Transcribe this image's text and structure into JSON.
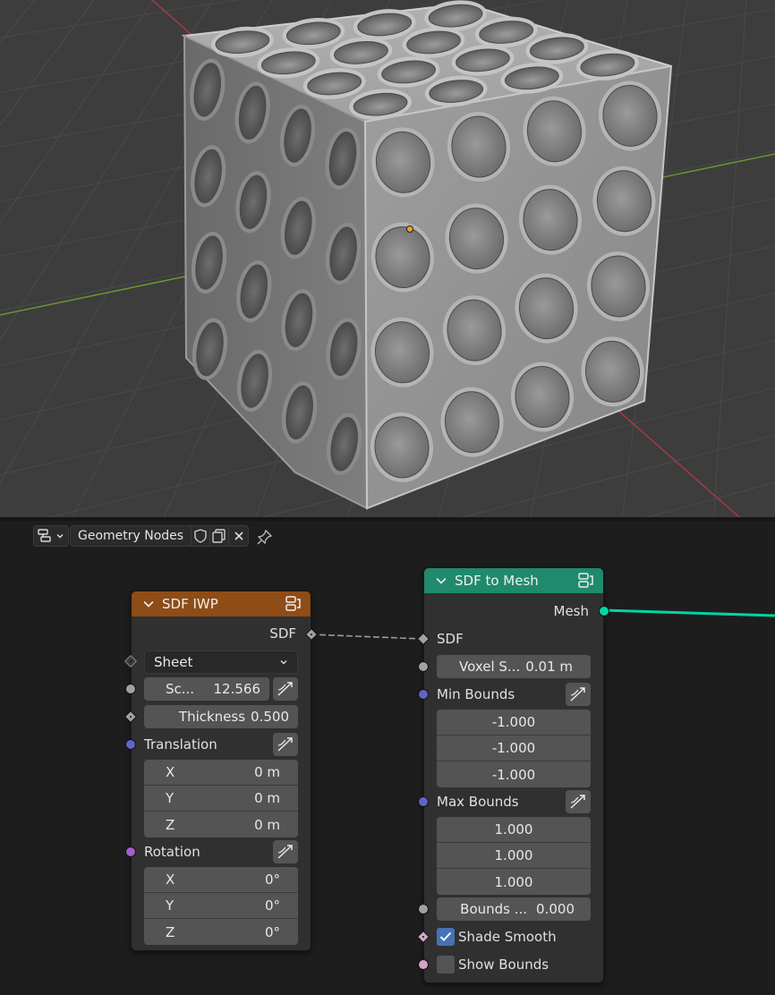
{
  "header": {
    "editor_type_icon": "node-editor-icon",
    "node_group_name": "Geometry Nodes",
    "icons": [
      "fake-user-shield-icon",
      "duplicate-icon",
      "close-icon",
      "pin-icon"
    ]
  },
  "nodes": {
    "sdf_iwp": {
      "title": "SDF IWP",
      "header_color": "#8e4c16",
      "output_sdf": "SDF",
      "mode": "Sheet",
      "scale_label": "Sc...",
      "scale_value": "12.566",
      "thickness_label": "Thickness",
      "thickness_value": "0.500",
      "translation_label": "Translation",
      "translation": [
        {
          "axis": "X",
          "value": "0 m"
        },
        {
          "axis": "Y",
          "value": "0 m"
        },
        {
          "axis": "Z",
          "value": "0 m"
        }
      ],
      "rotation_label": "Rotation",
      "rotation": [
        {
          "axis": "X",
          "value": "0°"
        },
        {
          "axis": "Y",
          "value": "0°"
        },
        {
          "axis": "Z",
          "value": "0°"
        }
      ]
    },
    "sdf_to_mesh": {
      "title": "SDF to Mesh",
      "header_color": "#1f8a6c",
      "output_mesh": "Mesh",
      "input_sdf": "SDF",
      "voxel_label": "Voxel S...",
      "voxel_value": "0.01 m",
      "min_bounds_label": "Min Bounds",
      "min_bounds": [
        "-1.000",
        "-1.000",
        "-1.000"
      ],
      "max_bounds_label": "Max Bounds",
      "max_bounds": [
        "1.000",
        "1.000",
        "1.000"
      ],
      "bounds_label": "Bounds ...",
      "bounds_value": "0.000",
      "shade_smooth_label": "Shade Smooth",
      "shade_smooth": true,
      "show_bounds_label": "Show Bounds",
      "show_bounds": false
    }
  },
  "colors": {
    "viewport_bg": "#3d3d3d",
    "editor_bg": "#1d1d1d",
    "mesh_link": "#00d6a3",
    "x_axis": "#b2393e",
    "y_axis": "#6c9a2c",
    "origin": "#f0a030"
  }
}
